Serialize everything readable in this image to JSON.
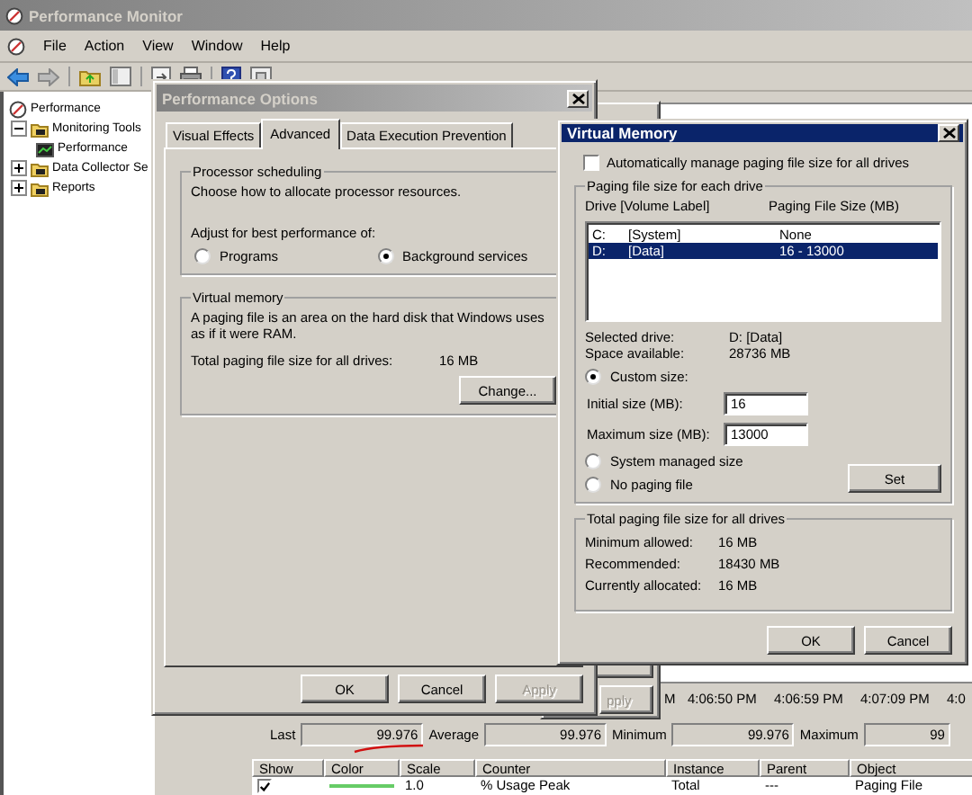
{
  "main_window": {
    "title": "Performance Monitor",
    "menu": [
      "File",
      "Action",
      "View",
      "Window",
      "Help"
    ],
    "tree": [
      {
        "label": "Performance",
        "children": [
          {
            "label": "Monitoring Tools",
            "expanded": true,
            "children": [
              {
                "label": "Performance"
              }
            ]
          },
          {
            "label": "Data Collector Se",
            "expanded": false
          },
          {
            "label": "Reports",
            "expanded": false
          }
        ]
      }
    ],
    "time_axis": [
      "M",
      "4:06:50 PM",
      "4:06:59 PM",
      "4:07:09 PM",
      "4:0"
    ],
    "stats": [
      {
        "label": "Last",
        "value": "99.976"
      },
      {
        "label": "Average",
        "value": "99.976"
      },
      {
        "label": "Minimum",
        "value": "99.976"
      },
      {
        "label": "Maximum",
        "value": "99"
      }
    ],
    "counters": {
      "columns": [
        "Show",
        "Color",
        "Scale",
        "Counter",
        "Instance",
        "Parent",
        "Object"
      ],
      "rows": [
        {
          "show": true,
          "color": "#66cc66",
          "scale": "1.0",
          "counter": "% Usage Peak",
          "instance": "Total",
          "parent": "---",
          "object": "Paging File"
        }
      ]
    }
  },
  "background_dialog": {
    "buttons": [
      {
        "label": "pply",
        "disabled": true
      }
    ]
  },
  "performance_options": {
    "title": "Performance Options",
    "tabs": [
      {
        "label": "Visual Effects",
        "selected": false
      },
      {
        "label": "Advanced",
        "selected": true
      },
      {
        "label": "Data Execution Prevention",
        "selected": false
      }
    ],
    "processor_scheduling": {
      "title": "Processor scheduling",
      "description": "Choose how to allocate processor resources.",
      "adjust_label": "Adjust for best performance of:",
      "options": [
        {
          "label": "Programs",
          "selected": false
        },
        {
          "label": "Background services",
          "selected": true
        }
      ]
    },
    "virtual_memory": {
      "title": "Virtual memory",
      "description": "A paging file is an area on the hard disk that Windows uses as if it were RAM.",
      "total_label": "Total paging file size for all drives:",
      "total_value": "16 MB",
      "button": "Change..."
    },
    "buttons": [
      {
        "label": "OK",
        "disabled": false
      },
      {
        "label": "Cancel",
        "disabled": false
      },
      {
        "label": "Apply",
        "disabled": true
      }
    ]
  },
  "virtual_memory": {
    "title": "Virtual Memory",
    "auto_manage": {
      "label": "Automatically manage paging file size for all drives",
      "checked": false
    },
    "drives_group": {
      "title": "Paging file size for each drive",
      "columns": [
        "Drive  [Volume Label]",
        "Paging File Size (MB)"
      ],
      "rows": [
        {
          "drive": "C:",
          "volume": "[System]",
          "size": "None",
          "selected": false
        },
        {
          "drive": "D:",
          "volume": "[Data]",
          "size": "16 - 13000",
          "selected": true
        }
      ],
      "info": [
        {
          "label": "Selected drive:",
          "value": "D:  [Data]"
        },
        {
          "label": "Space available:",
          "value": "28736 MB"
        }
      ],
      "choices": [
        {
          "label": "Custom size:",
          "selected": true,
          "fields": [
            {
              "label": "Initial size (MB):",
              "value": "16"
            },
            {
              "label": "Maximum size (MB):",
              "value": "13000"
            }
          ]
        },
        {
          "label": "System managed size",
          "selected": false
        },
        {
          "label": "No paging file",
          "selected": false
        }
      ],
      "set_button": "Set"
    },
    "totals_group": {
      "title": "Total paging file size for all drives",
      "rows": [
        {
          "label": "Minimum allowed:",
          "value": "16 MB"
        },
        {
          "label": "Recommended:",
          "value": "18430 MB"
        },
        {
          "label": "Currently allocated:",
          "value": "16 MB"
        }
      ]
    },
    "buttons": [
      {
        "label": "OK",
        "disabled": false
      },
      {
        "label": "Cancel",
        "disabled": false
      }
    ]
  }
}
